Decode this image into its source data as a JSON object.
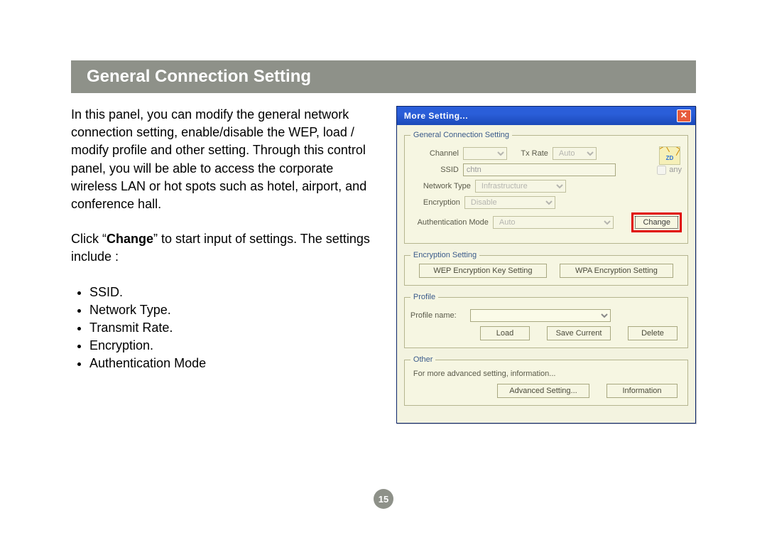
{
  "title": "General Connection Setting",
  "page_number": "15",
  "intro": "In this panel, you can modify the general network connection setting, enable/disable the WEP, load / modify profile and other setting. Through this control panel, you will be able to access the corporate wireless LAN or hot spots such as hotel, airport, and conference hall.",
  "click_change_pre": "Click “",
  "click_change_bold": "Change",
  "click_change_post": "” to start input of settings. The settings include :",
  "bullets": [
    "SSID.",
    "Network Type.",
    "Transmit Rate.",
    "Encryption.",
    "Authentication Mode"
  ],
  "dialog": {
    "title": "More Setting...",
    "groups": {
      "general": {
        "legend": "General Connection Setting",
        "labels": {
          "channel": "Channel",
          "txrate": "Tx Rate",
          "ssid": "SSID",
          "any": "any",
          "nettype": "Network Type",
          "encrypt": "Encryption",
          "auth": "Authentication Mode"
        },
        "values": {
          "channel": "",
          "txrate": "Auto",
          "ssid": "chtn",
          "nettype": "Infrastructure",
          "encrypt": "Disable",
          "auth": "Auto"
        },
        "change_btn": "Change",
        "logo": "ZD"
      },
      "encryption": {
        "legend": "Encryption Setting",
        "wep_btn": "WEP Encryption Key Setting",
        "wpa_btn": "WPA Encryption Setting"
      },
      "profile": {
        "legend": "Profile",
        "name_label": "Profile name:",
        "load_btn": "Load",
        "save_btn": "Save Current",
        "delete_btn": "Delete"
      },
      "other": {
        "legend": "Other",
        "note": "For more advanced setting, information...",
        "adv_btn": "Advanced Setting...",
        "info_btn": "Information"
      }
    }
  }
}
